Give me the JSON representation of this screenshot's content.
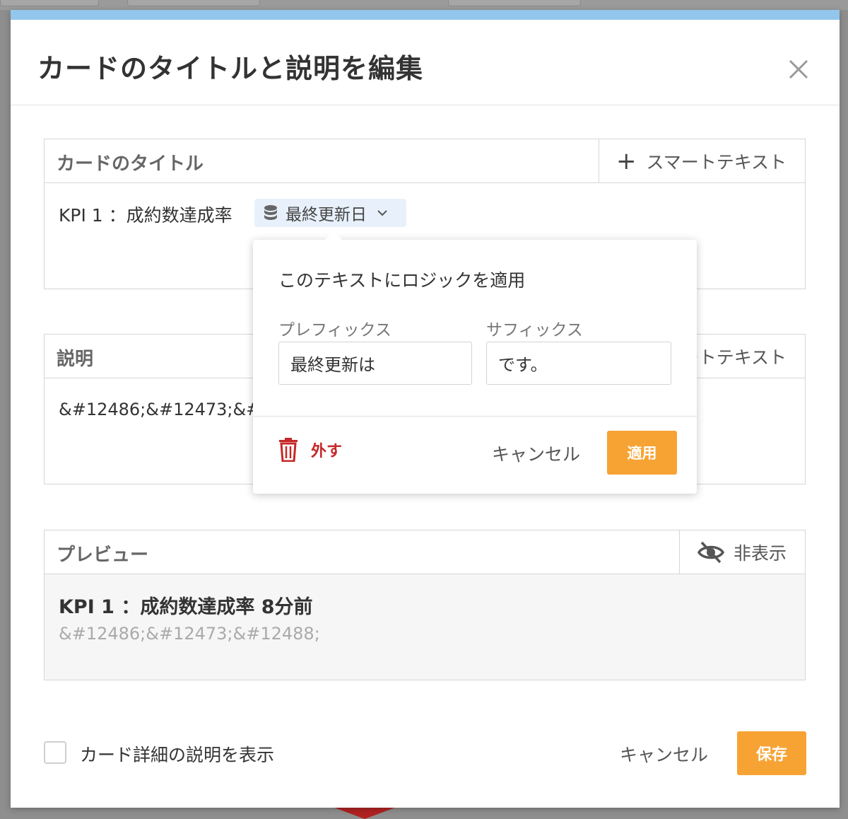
{
  "modal": {
    "title": "カードのタイトルと説明を編集",
    "close_icon": "close-icon"
  },
  "title_panel": {
    "label": "カードのタイトル",
    "smart_text_button": "スマートテキスト",
    "text": "KPI 1 ：成約数達成率",
    "token": {
      "label": "最終更新日",
      "icon": "database-icon"
    }
  },
  "description_panel": {
    "label": "説明",
    "smart_text_button": "ートテキスト",
    "text": "&#12486;&#12473;&#"
  },
  "preview_panel": {
    "label": "プレビュー",
    "hide_button": "非表示",
    "hide_icon": "eye-slash-icon",
    "title": "KPI 1 ：成約数達成率 8分前",
    "description": "&#12486;&#12473;&#12488;"
  },
  "popover": {
    "title": "このテキストにロジックを適用",
    "prefix_label": "プレフィックス",
    "prefix_value": "最終更新は",
    "suffix_label": "サフィックス",
    "suffix_value": "です。",
    "remove_label": "外す",
    "cancel_label": "キャンセル",
    "apply_label": "適用"
  },
  "footer": {
    "checkbox_label": "カード詳細の説明を表示",
    "checkbox_checked": false,
    "cancel_label": "キャンセル",
    "save_label": "保存"
  },
  "colors": {
    "accent": "#f7a334",
    "header_strip": "#93c6ec",
    "token_bg": "#e8f1fb",
    "danger": "#c62828"
  }
}
